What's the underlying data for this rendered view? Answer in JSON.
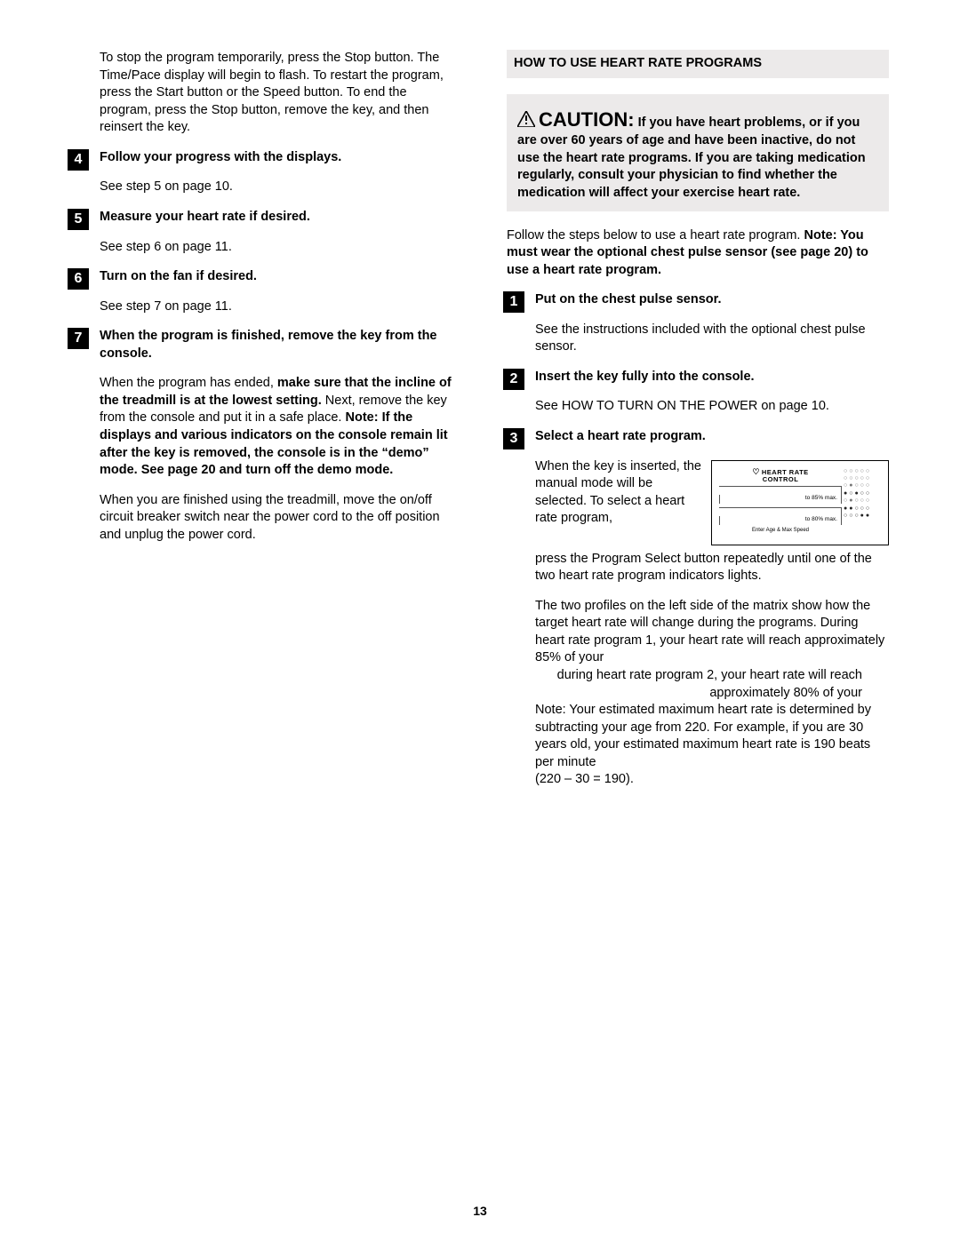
{
  "page_number": "13",
  "left": {
    "intro": "To stop the program temporarily, press the Stop button. The Time/Pace display will begin to flash. To restart the program, press the Start button or the Speed    button. To end the program, press the Stop button, remove the key, and then reinsert the key.",
    "step4": {
      "num": "4",
      "title": "Follow your progress with the displays.",
      "body": "See step 5 on page 10."
    },
    "step5": {
      "num": "5",
      "title": "Measure your heart rate if desired.",
      "body": "See step 6 on page 11."
    },
    "step6": {
      "num": "6",
      "title": "Turn on the fan if desired.",
      "body": "See step 7 on page 11."
    },
    "step7": {
      "num": "7",
      "title": "When the program is finished, remove the key from the console.",
      "para1_a": "When the program has ended, ",
      "para1_b": "make sure that the incline of the treadmill is at the lowest setting.",
      "para1_c": " Next, remove the key from the console and put it in a safe place. ",
      "para1_d": "Note: If the displays and various indicators on the console remain lit after the key is removed, the console is in the “demo” mode. See page 20 and turn off the demo mode.",
      "para2": "When you are finished using the treadmill, move the on/off circuit breaker switch near the power cord to the off position and unplug the power cord."
    }
  },
  "right": {
    "heading": "HOW TO USE HEART RATE PROGRAMS",
    "caution_title": "CAUTION:",
    "caution_body": " If you have heart problems, or if you are over 60 years of age and have been inactive, do not use the heart rate programs. If you are taking medication regularly, consult your physician to find whether the medication will affect your exercise heart rate.",
    "intro_a": "Follow the steps below to use a heart rate program. ",
    "intro_b": "Note: You must wear the optional chest pulse sensor (see page 20) to use a heart rate program.",
    "step1": {
      "num": "1",
      "title": "Put on the chest pulse sensor.",
      "body": "See the instructions included with the optional chest pulse sensor."
    },
    "step2": {
      "num": "2",
      "title": "Insert the key fully into the console.",
      "body": "See HOW TO TURN ON THE POWER on page 10."
    },
    "step3": {
      "num": "3",
      "title": "Select a heart rate program.",
      "diagram": {
        "label_line1": "HEART RATE",
        "label_line2": "CONTROL",
        "p85": "to 85% max.",
        "p80": "to 80% max.",
        "enter": "Enter Age & Max Speed"
      },
      "para1": "When the key is inserted, the manual mode will be selected. To select a heart rate program,",
      "para1b": "press the Program Select button repeatedly until one of the two heart rate program indicators lights.",
      "para2": "The two profiles on the left side of the matrix show how the target heart rate will change during the programs. During heart rate program 1, your heart rate will reach approximately 85% of your",
      "para2b": "during heart rate program 2, your heart rate will reach approximately 80% of your",
      "para3": "Note: Your estimated maximum heart rate is determined by subtracting your age from 220. For example, if you are 30 years old, your estimated maximum heart rate is 190 beats per minute",
      "para3b": "(220 – 30 = 190)."
    }
  }
}
